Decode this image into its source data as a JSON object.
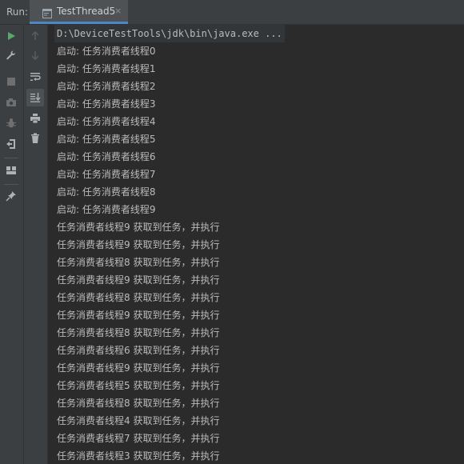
{
  "run_bar": {
    "label": "Run:",
    "tab_title": "TestThread5"
  },
  "toolbar_left": [
    {
      "name": "rerun-icon",
      "color": "#59a869"
    },
    {
      "name": "wrench-icon",
      "color": "#afb1b3"
    },
    {
      "name": "stop-icon",
      "color": "#6f6f6f"
    },
    {
      "name": "camera-icon",
      "color": "#6f6f6f"
    },
    {
      "name": "bug-icon",
      "color": "#6f6f6f"
    },
    {
      "name": "exit-icon",
      "color": "#afb1b3"
    },
    {
      "name": "layout-icon",
      "color": "#afb1b3"
    },
    {
      "name": "pin-icon",
      "color": "#afb1b3"
    }
  ],
  "toolbar_right": [
    {
      "name": "arrow-up-icon"
    },
    {
      "name": "arrow-down-icon"
    },
    {
      "name": "soft-wrap-icon"
    },
    {
      "name": "scroll-to-end-icon"
    },
    {
      "name": "print-icon"
    },
    {
      "name": "trash-icon"
    }
  ],
  "console": {
    "command": "D:\\DeviceTestTools\\jdk\\bin\\java.exe ...",
    "lines": [
      "启动: 任务消费者线程0",
      "启动: 任务消费者线程1",
      "启动: 任务消费者线程2",
      "启动: 任务消费者线程3",
      "启动: 任务消费者线程4",
      "启动: 任务消费者线程5",
      "启动: 任务消费者线程6",
      "启动: 任务消费者线程7",
      "启动: 任务消费者线程8",
      "启动: 任务消费者线程9",
      "任务消费者线程9 获取到任务，并执行",
      "任务消费者线程9 获取到任务，并执行",
      "任务消费者线程8 获取到任务，并执行",
      "任务消费者线程9 获取到任务，并执行",
      "任务消费者线程8 获取到任务，并执行",
      "任务消费者线程9 获取到任务，并执行",
      "任务消费者线程8 获取到任务，并执行",
      "任务消费者线程6 获取到任务，并执行",
      "任务消费者线程9 获取到任务，并执行",
      "任务消费者线程5 获取到任务，并执行",
      "任务消费者线程8 获取到任务，并执行",
      "任务消费者线程4 获取到任务，并执行",
      "任务消费者线程7 获取到任务，并执行",
      "任务消费者线程3 获取到任务，并执行"
    ]
  }
}
